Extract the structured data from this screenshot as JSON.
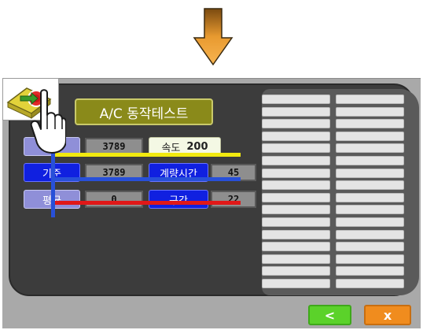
{
  "title": "A/C 동작테스트",
  "rows": [
    {
      "label": "",
      "value": "3789"
    },
    {
      "label": "기준",
      "value": "3789"
    },
    {
      "label": "평균",
      "value": "0"
    }
  ],
  "speed": {
    "label": "속도",
    "value": "200"
  },
  "weigh_time": {
    "label": "계량시간",
    "value": "45"
  },
  "section": {
    "label": "구간",
    "value": "22"
  },
  "buttons": {
    "back": "<",
    "close": "x"
  },
  "colors": {
    "arrow": "#f0a030",
    "line_yellow": "#f2ea10",
    "line_blue": "#2850d8",
    "line_red": "#e01818",
    "label_blue": "#1020e0",
    "title_olive": "#8a8a1a"
  },
  "icons": {
    "arrow": "down-arrow-icon",
    "hand": "hand-pointer-icon",
    "finger": "finger-press-icon"
  }
}
